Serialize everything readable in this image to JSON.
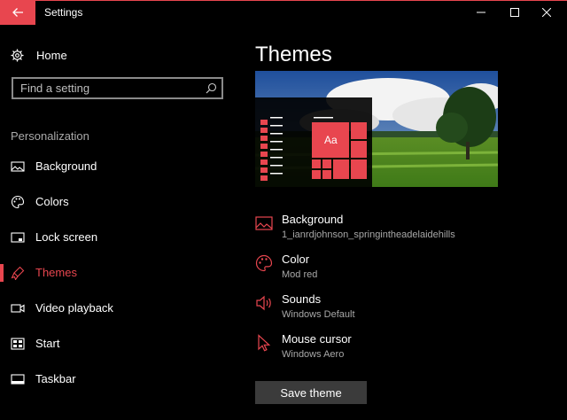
{
  "window": {
    "title": "Settings",
    "accent_color": "#e8464f"
  },
  "sidebar": {
    "home_label": "Home",
    "search_placeholder": "Find a setting",
    "section_header": "Personalization",
    "items": [
      {
        "label": "Background",
        "icon": "image-icon",
        "active": false
      },
      {
        "label": "Colors",
        "icon": "palette-icon",
        "active": false
      },
      {
        "label": "Lock screen",
        "icon": "lock-screen-icon",
        "active": false
      },
      {
        "label": "Themes",
        "icon": "themes-icon",
        "active": true
      },
      {
        "label": "Video playback",
        "icon": "video-icon",
        "active": false
      },
      {
        "label": "Start",
        "icon": "start-icon",
        "active": false
      },
      {
        "label": "Taskbar",
        "icon": "taskbar-icon",
        "active": false
      }
    ]
  },
  "main": {
    "title": "Themes",
    "preview": {
      "tile_label": "Aa"
    },
    "properties": [
      {
        "name": "Background",
        "value": "1_ianrdjohnson_springintheadelaidehills",
        "icon": "picture-icon"
      },
      {
        "name": "Color",
        "value": "Mod red",
        "icon": "palette-icon"
      },
      {
        "name": "Sounds",
        "value": "Windows Default",
        "icon": "speaker-icon"
      },
      {
        "name": "Mouse cursor",
        "value": "Windows Aero",
        "icon": "cursor-icon"
      }
    ],
    "save_label": "Save theme"
  }
}
